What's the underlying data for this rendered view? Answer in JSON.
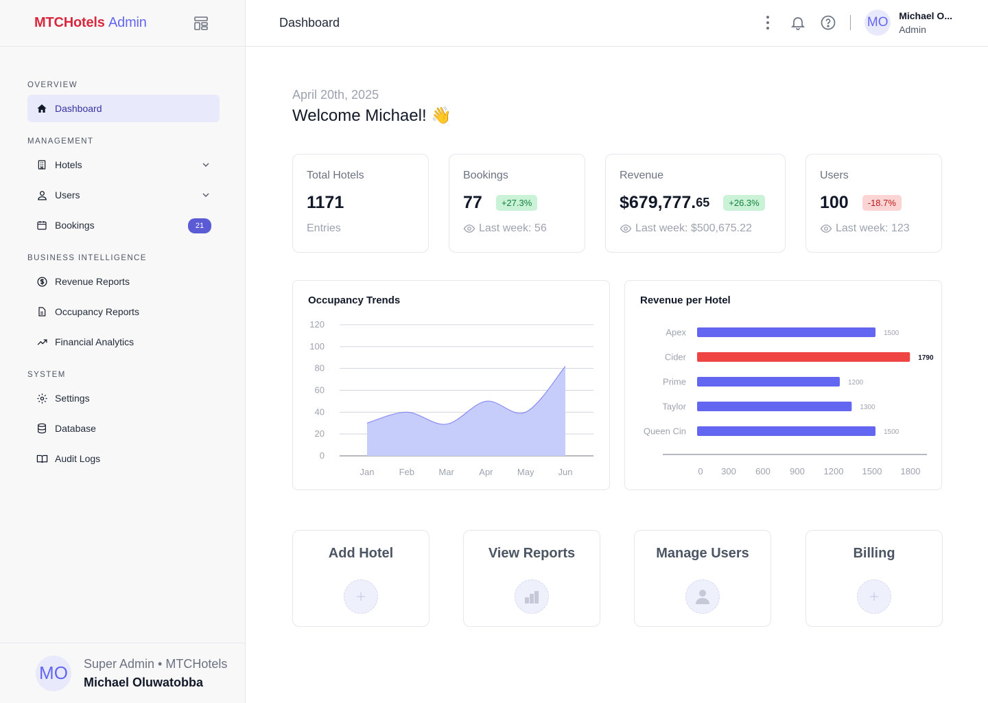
{
  "sidebar": {
    "brand_part1": "MTCHotels",
    "brand_part2": "Admin",
    "sections": [
      {
        "title": "OVERVIEW"
      },
      {
        "title": "MANAGEMENT"
      },
      {
        "title": "BUSINESS INTELLIGENCE"
      },
      {
        "title": "SYSTEM"
      }
    ],
    "items": {
      "dashboard": "Dashboard",
      "hotels": "Hotels",
      "users": "Users",
      "bookings": "Bookings",
      "bookings_badge": "21",
      "revenue_reports": "Revenue Reports",
      "occupancy_reports": "Occupancy Reports",
      "financial_analytics": "Financial Analytics",
      "settings": "Settings",
      "database": "Database",
      "audit_logs": "Audit Logs"
    },
    "profile": {
      "initials": "MO",
      "role": "Super Admin • MTCHotels",
      "name": "Michael Oluwatobba"
    }
  },
  "header": {
    "title": "Dashboard",
    "user_initials": "MO",
    "user_name": "Michael O...",
    "user_role": "Admin"
  },
  "main": {
    "date": "April 20th, 2025",
    "welcome": "Welcome Michael! 👋",
    "stats": {
      "hotels": {
        "label": "Total Hotels",
        "value": "1171",
        "sub": "Entries"
      },
      "bookings": {
        "label": "Bookings",
        "value": "77",
        "change": "+27.3%",
        "sub": "Last week: 56"
      },
      "revenue": {
        "label": "Revenue",
        "value_main": "$679,777.",
        "value_cents": "65",
        "change": "+26.3%",
        "sub": "Last week: $500,675.22"
      },
      "users": {
        "label": "Users",
        "value": "100",
        "change": "-18.7%",
        "sub": "Last week: 123"
      }
    },
    "actions": {
      "add_hotel": "Add Hotel",
      "view_reports": "View Reports",
      "manage_users": "Manage Users",
      "billing": "Billing"
    }
  },
  "colors": {
    "brand_red": "#d8283e",
    "accent": "#6366f1",
    "bar": "#6366f1",
    "bar_highlight": "#ef4444",
    "area_fill": "#c7cdfb",
    "area_line": "#6366f1"
  },
  "chart_data": [
    {
      "type": "area",
      "title": "Occupancy Trends",
      "categories": [
        "Jan",
        "Feb",
        "Mar",
        "Apr",
        "May",
        "Jun"
      ],
      "values": [
        30,
        40,
        29,
        50,
        40,
        82
      ],
      "ylim": [
        0,
        120
      ],
      "yticks": [
        0,
        20,
        40,
        60,
        80,
        100,
        120
      ],
      "grid": true
    },
    {
      "type": "bar",
      "orientation": "horizontal",
      "title": "Revenue per Hotel",
      "categories": [
        "Apex",
        "Cider",
        "Prime",
        "Taylor",
        "Queen Cin"
      ],
      "values": [
        1500,
        1790,
        1200,
        1300,
        1500
      ],
      "highlight_index": 1,
      "xlim": [
        0,
        1800
      ],
      "xticks": [
        0,
        300,
        600,
        900,
        1200,
        1500,
        1800
      ]
    }
  ]
}
